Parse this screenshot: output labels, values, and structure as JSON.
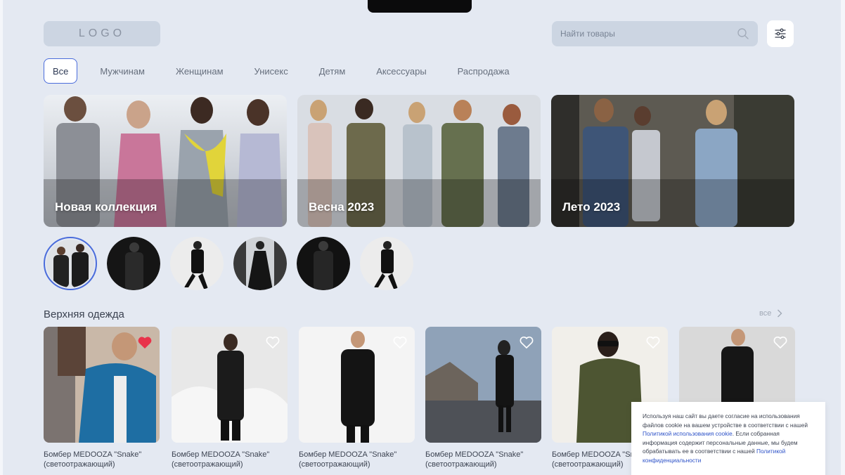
{
  "header": {
    "logo": "LOGO",
    "search_placeholder": "Найти товары"
  },
  "tabs": [
    {
      "label": "Все",
      "active": true
    },
    {
      "label": "Мужчинам"
    },
    {
      "label": "Женщинам"
    },
    {
      "label": "Унисекс"
    },
    {
      "label": "Детям"
    },
    {
      "label": "Аксессуары"
    },
    {
      "label": "Распродажа"
    }
  ],
  "banners": [
    {
      "title": "Новая коллекция"
    },
    {
      "title": "Весна 2023"
    },
    {
      "title": "Лето 2023"
    }
  ],
  "section": {
    "title": "Верхняя одежда",
    "see_all": "все"
  },
  "products": [
    {
      "name": "Бомбер MEDOOZA \"Snake\" (светоотражающий)",
      "favorite": true
    },
    {
      "name": "Бомбер MEDOOZA \"Snake\" (светоотражающий)",
      "favorite": false
    },
    {
      "name": "Бомбер MEDOOZA \"Snake\" (светоотражающий)",
      "favorite": false
    },
    {
      "name": "Бомбер MEDOOZA \"Snake\" (светоотражающий)",
      "favorite": false
    },
    {
      "name": "Бомбер MEDOOZA \"Snake\" (светоотражающий)",
      "favorite": false
    },
    {
      "name": "",
      "favorite": false
    }
  ],
  "cookie": {
    "text_1": "Используя наш сайт вы даете согласие на использования файлов cookie на вашем устройстве в соответствии с нашей ",
    "link_1": "Политикой использования cookie",
    "text_2": ". Если собранная информация содержит персональные данные, мы будем обрабатывать ее в соответствии с нашей ",
    "link_2": "Политикой конфиденциальности"
  },
  "colors": {
    "background": "#e4e9f2",
    "accent": "#4a6cdb",
    "favorite": "#e8334a"
  }
}
